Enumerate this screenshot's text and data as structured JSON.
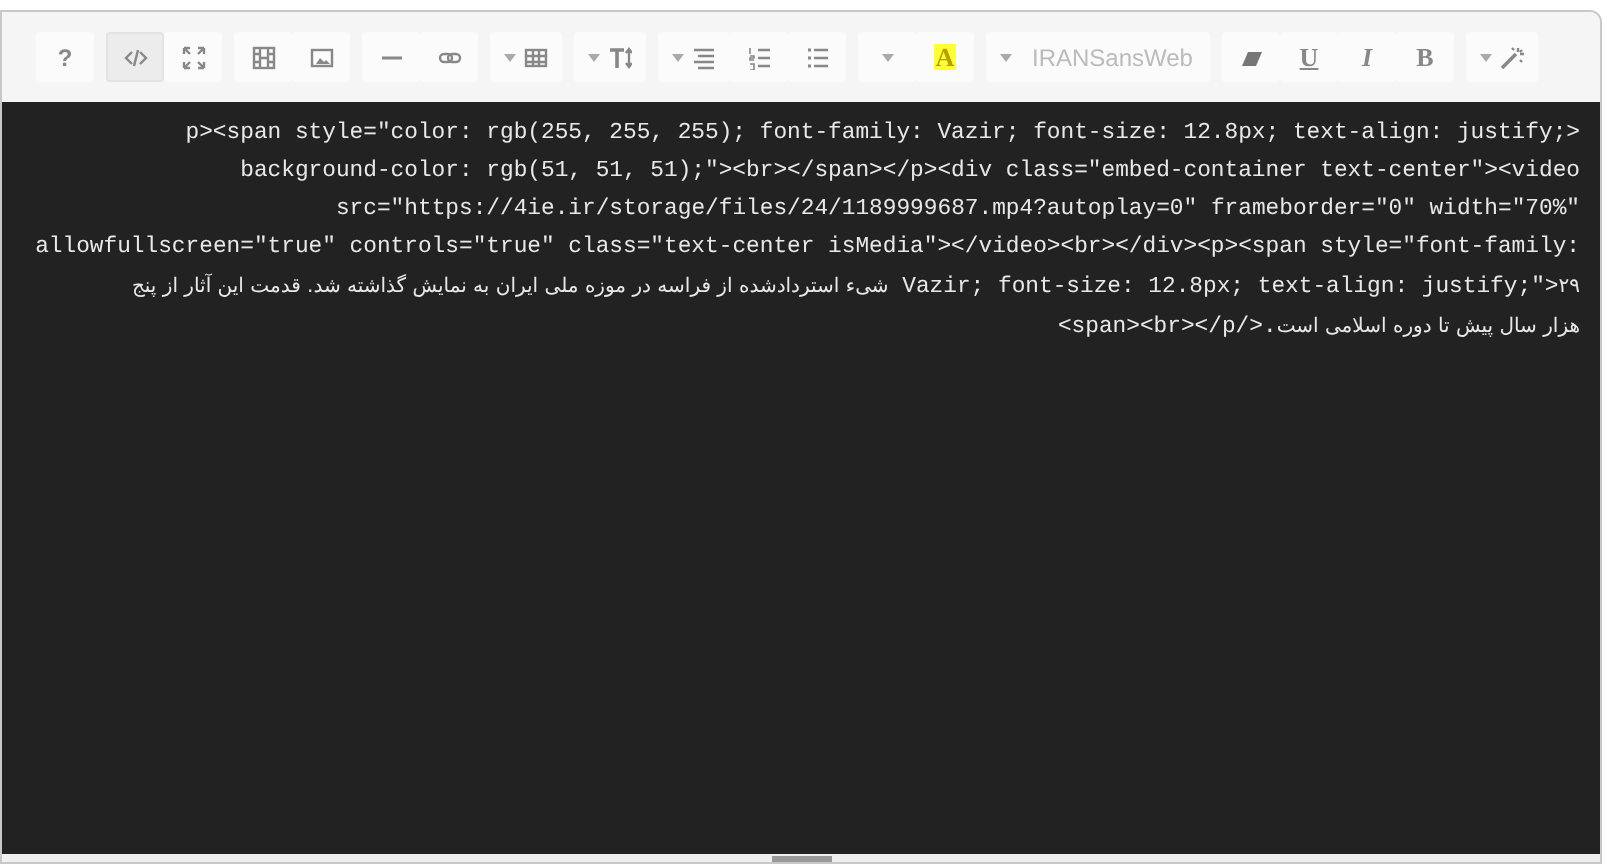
{
  "toolbar": {
    "groups": [
      {
        "buttons": [
          {
            "kind": "help",
            "label": "?",
            "selected": false
          }
        ]
      },
      {
        "buttons": [
          {
            "kind": "code",
            "selected": true
          },
          {
            "kind": "fullscreen",
            "selected": false
          }
        ]
      },
      {
        "buttons": [
          {
            "kind": "video",
            "selected": false
          },
          {
            "kind": "picture",
            "selected": false
          }
        ]
      },
      {
        "buttons": [
          {
            "kind": "hr",
            "selected": false
          },
          {
            "kind": "link",
            "selected": false
          }
        ]
      },
      {
        "buttons": [
          {
            "kind": "table",
            "dropdown": true,
            "selected": false
          }
        ]
      },
      {
        "buttons": [
          {
            "kind": "fontsize",
            "dropdown": true,
            "selected": false
          }
        ]
      },
      {
        "buttons": [
          {
            "kind": "paragraph",
            "dropdown": true,
            "selected": false
          },
          {
            "kind": "ol",
            "selected": false
          },
          {
            "kind": "ul",
            "selected": false
          }
        ]
      },
      {
        "buttons": [
          {
            "kind": "caret",
            "dropdown": true,
            "selected": false
          },
          {
            "kind": "color",
            "label": "A",
            "selected": false
          }
        ]
      },
      {
        "buttons": [
          {
            "kind": "fontname",
            "label": "IRANSansWeb",
            "dropdown": true,
            "selected": false
          }
        ]
      },
      {
        "buttons": [
          {
            "kind": "eraser",
            "selected": false
          },
          {
            "kind": "underline",
            "label": "U",
            "selected": false
          },
          {
            "kind": "italic",
            "label": "I",
            "selected": false
          },
          {
            "kind": "bold",
            "label": "B",
            "selected": false
          }
        ]
      },
      {
        "buttons": [
          {
            "kind": "magic",
            "dropdown": true,
            "selected": false
          }
        ]
      }
    ]
  },
  "code_view": {
    "lines": [
      "p><span style=\"color: rgb(255, 255, 255); font-family: Vazir; font-size: 12.8px; text-align: justify;>",
      "background-color: rgb(51, 51, 51);\"><br></span></p><div class=\"embed-container text-center\"><video",
      "src=\"https://4ie.ir/storage/files/24/1189999687.mp4?autoplay=0\" frameborder=\"0\" width=\"70%\"",
      "allowfullscreen=\"true\" controls=\"true\" class=\"text-center isMedia\"></video><br></div><p><span style=\"font-family:",
      "شیء استردادشده از فراسه در موزه ملی ایران به نمایش گذاشته شد. قدمت این آثار از پنج Vazir; font-size: 12.8px; text-align: justify;\">۲۹",
      "<span><br></p/>.هزار سال پیش تا دوره اسلامی است"
    ]
  }
}
